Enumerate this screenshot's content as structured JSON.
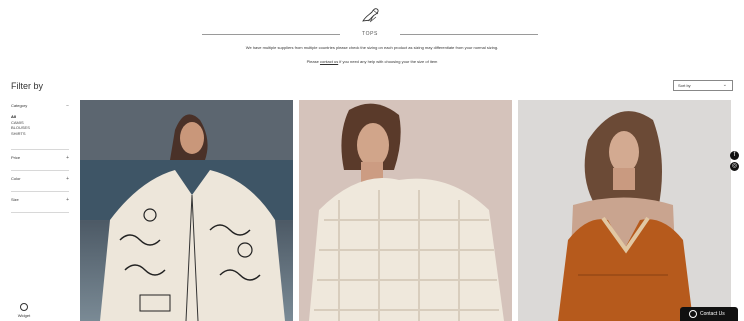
{
  "header": {
    "page_title": "TOPS",
    "notice": "We have multiple suppliers from multiple countries please check the sizing on each product as sizing may differentiate from your normal sizing.",
    "help_prefix": "Please",
    "help_link": "contact us",
    "help_suffix": "if you need any help with choosing your the size of item"
  },
  "filter": {
    "title": "Filter by",
    "sections": [
      {
        "label": "Category",
        "sign": "−",
        "options": [
          "All",
          "CAMIS",
          "BLOUSES",
          "SHIRTS"
        ],
        "active": 0
      },
      {
        "label": "Price",
        "sign": "+"
      },
      {
        "label": "Color",
        "sign": "+"
      },
      {
        "label": "Size",
        "sign": "+"
      }
    ]
  },
  "sort": {
    "label": "Sort by"
  },
  "products": [
    {
      "icon": "product-image-printed-blouse"
    },
    {
      "icon": "product-image-lace-top"
    },
    {
      "icon": "product-image-orange-cami"
    }
  ],
  "social": {
    "facebook": "f",
    "instagram": "◎"
  },
  "widget": {
    "label": "Widget"
  },
  "contact": {
    "label": "Contact Us"
  }
}
